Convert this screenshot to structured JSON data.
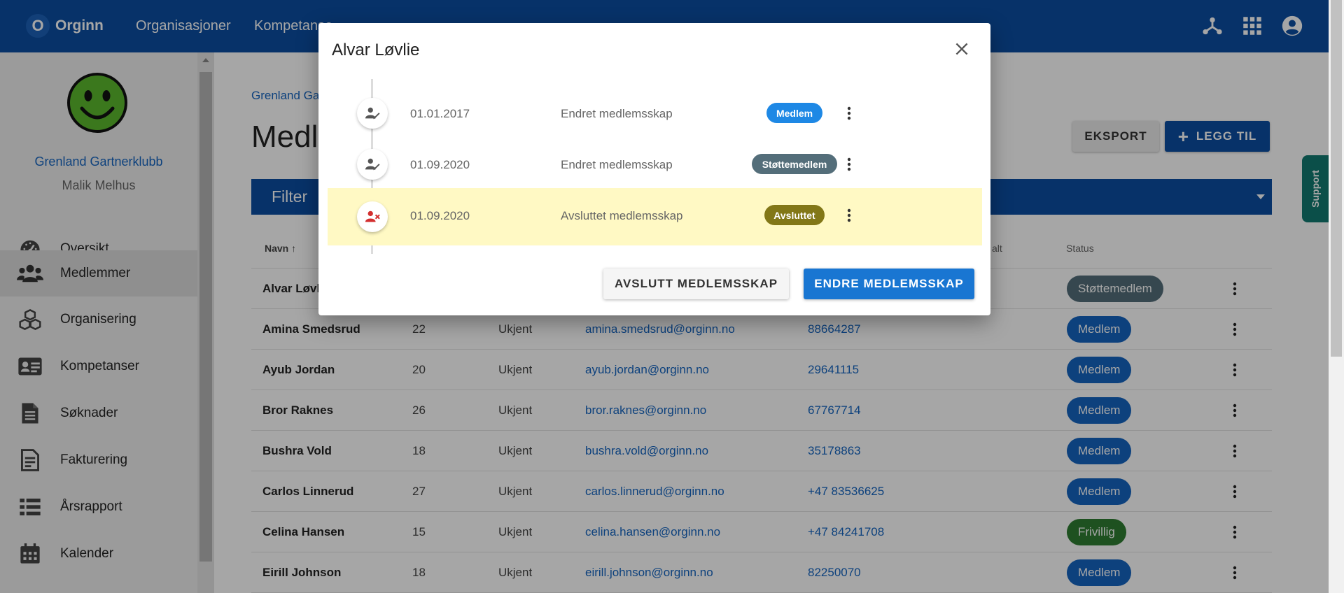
{
  "header": {
    "logo_letter": "O",
    "logo_text": "Orginn",
    "nav": [
      "Organisasjoner",
      "Kompetanse"
    ]
  },
  "sidebar": {
    "club_name": "Grenland Gartnerklubb",
    "user_name": "Malik Melhus",
    "items": [
      {
        "label": "Oversikt",
        "icon": "speedometer-icon"
      },
      {
        "label": "Medlemmer",
        "icon": "people-icon"
      },
      {
        "label": "Organisering",
        "icon": "cubes-icon"
      },
      {
        "label": "Kompetanser",
        "icon": "id-card-icon"
      },
      {
        "label": "Søknader",
        "icon": "document-icon"
      },
      {
        "label": "Fakturering",
        "icon": "invoice-icon"
      },
      {
        "label": "Årsrapport",
        "icon": "list-icon"
      },
      {
        "label": "Kalender",
        "icon": "calendar-icon"
      }
    ]
  },
  "main": {
    "breadcrumb": "Grenland Gar",
    "title": "Medle",
    "export_label": "EKSPORT",
    "add_label": "LEGG TIL",
    "filter_label": "Filter",
    "columns": {
      "name": "Navn",
      "partial": "alt",
      "status": "Status"
    },
    "rows": [
      {
        "name": "Alvar Løvli",
        "age": "",
        "gender": "",
        "email": "",
        "phone": "",
        "status": "Støttemedlem"
      },
      {
        "name": "Amina Smedsrud",
        "age": "22",
        "gender": "Ukjent",
        "email": "amina.smedsrud@orginn.no",
        "phone": "88664287",
        "status": "Medlem"
      },
      {
        "name": "Ayub Jordan",
        "age": "20",
        "gender": "Ukjent",
        "email": "ayub.jordan@orginn.no",
        "phone": "29641115",
        "status": "Medlem"
      },
      {
        "name": "Bror Raknes",
        "age": "26",
        "gender": "Ukjent",
        "email": "bror.raknes@orginn.no",
        "phone": "67767714",
        "status": "Medlem"
      },
      {
        "name": "Bushra Vold",
        "age": "18",
        "gender": "Ukjent",
        "email": "bushra.vold@orginn.no",
        "phone": "35178863",
        "status": "Medlem"
      },
      {
        "name": "Carlos Linnerud",
        "age": "27",
        "gender": "Ukjent",
        "email": "carlos.linnerud@orginn.no",
        "phone": "+47 83536625",
        "status": "Medlem"
      },
      {
        "name": "Celina Hansen",
        "age": "15",
        "gender": "Ukjent",
        "email": "celina.hansen@orginn.no",
        "phone": "+47 84241708",
        "status": "Frivillig"
      },
      {
        "name": "Eirill Johnson",
        "age": "18",
        "gender": "Ukjent",
        "email": "eirill.johnson@orginn.no",
        "phone": "82250070",
        "status": "Medlem"
      }
    ]
  },
  "support_label": "Support",
  "dialog": {
    "title": "Alvar Løvlie",
    "entries": [
      {
        "date": "01.01.2017",
        "description": "Endret medlemsskap",
        "badge": "Medlem",
        "icon": "user-edit-icon"
      },
      {
        "date": "01.09.2020",
        "description": "Endret medlemsskap",
        "badge": "Støttemedlem",
        "icon": "user-edit-icon"
      },
      {
        "date": "01.09.2020",
        "description": "Avsluttet medlemsskap",
        "badge": "Avsluttet",
        "icon": "user-remove-icon"
      }
    ],
    "end_label": "AVSLUTT MEDLEMSSKAP",
    "change_label": "ENDRE MEDLEMSSKAP"
  },
  "colors": {
    "primary": "#0b4ea2",
    "badge_member": "#1e88e5",
    "badge_support": "#546e7a",
    "badge_ended": "#827717",
    "status_member": "#1565c0",
    "status_support": "#546e7a",
    "status_volunteer": "#2e7d32",
    "highlight": "#fff9c4"
  }
}
